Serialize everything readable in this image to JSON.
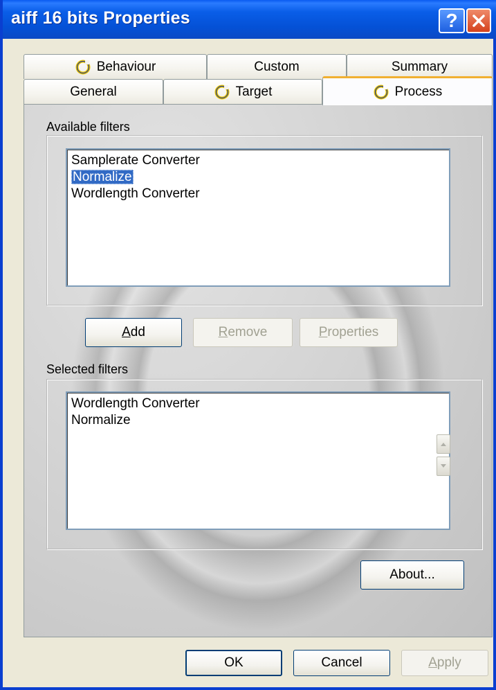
{
  "window": {
    "title": "aiff 16 bits Properties"
  },
  "titlebar_buttons": {
    "help": "?",
    "close": "✕"
  },
  "tabs_row1": [
    {
      "label": "Behaviour",
      "icon": "ring-icon"
    },
    {
      "label": "Custom"
    },
    {
      "label": "Summary"
    }
  ],
  "tabs_row2": [
    {
      "label": "General"
    },
    {
      "label": "Target",
      "icon": "ring-icon"
    },
    {
      "label": "Process",
      "icon": "ring-icon",
      "active": true
    }
  ],
  "available": {
    "label": "Available filters",
    "items": [
      "Samplerate Converter",
      "Normalize",
      "Wordlength Converter"
    ],
    "selected_index": 1
  },
  "buttons": {
    "add": {
      "pre": "",
      "u": "A",
      "post": "dd"
    },
    "remove": {
      "pre": "",
      "u": "R",
      "post": "emove"
    },
    "properties": {
      "pre": "",
      "u": "P",
      "post": "roperties"
    },
    "about": "About..."
  },
  "selected": {
    "label": "Selected filters",
    "items": [
      "Wordlength Converter",
      "Normalize"
    ]
  },
  "footer": {
    "ok": "OK",
    "cancel": "Cancel",
    "apply": {
      "u": "A",
      "post": "pply"
    }
  },
  "colors": {
    "titlebar": "#0451d6",
    "selection": "#316ac5",
    "active_tab_accent": "#f0b030",
    "ring": "#e8c400"
  }
}
